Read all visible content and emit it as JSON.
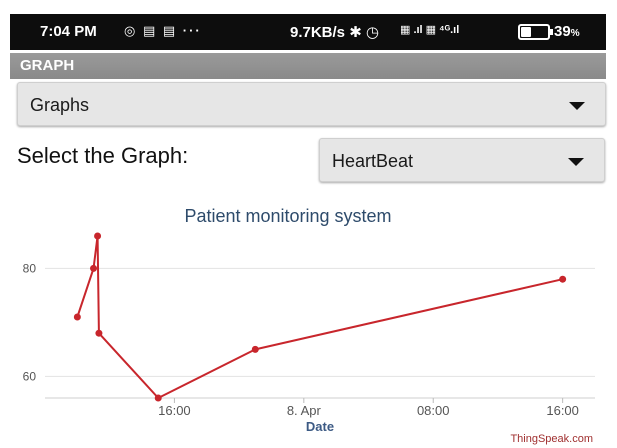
{
  "status_bar": {
    "time": "7:04 PM",
    "notif_icons": "◎ ▤ ▤  ···",
    "net_speed": "9.7KB/s ✱ ◷",
    "signal": "▦ .ıl ▦ ⁴ᴳ.ıl",
    "battery": "39",
    "battery_suffix": "%"
  },
  "app": {
    "title": "GRAPH"
  },
  "graphs_dropdown": {
    "selected": "Graphs"
  },
  "select_label": "Select the Graph:",
  "graph_dropdown": {
    "selected": "HeartBeat"
  },
  "watermark": "ThingSpeak.com",
  "chart_data": {
    "type": "line",
    "title": "Patient monitoring system",
    "xlabel": "Date",
    "ylabel": "",
    "x_ticks": [
      "16:00",
      "8. Apr",
      "08:00",
      "16:00"
    ],
    "y_ticks": [
      60,
      80
    ],
    "ylim": [
      56,
      86
    ],
    "grid": true,
    "series": [
      {
        "color": "#c8262c",
        "points": [
          {
            "x": "Apr 7, 10:00",
            "y": 71
          },
          {
            "x": "Apr 7, 11:00",
            "y": 80
          },
          {
            "x": "Apr 7, 11:15",
            "y": 86
          },
          {
            "x": "Apr 7, 11:20",
            "y": 68
          },
          {
            "x": "Apr 7, 15:00",
            "y": 56
          },
          {
            "x": "Apr 7, 21:00",
            "y": 65
          },
          {
            "x": "Apr 8, 16:00",
            "y": 78
          }
        ]
      }
    ]
  }
}
